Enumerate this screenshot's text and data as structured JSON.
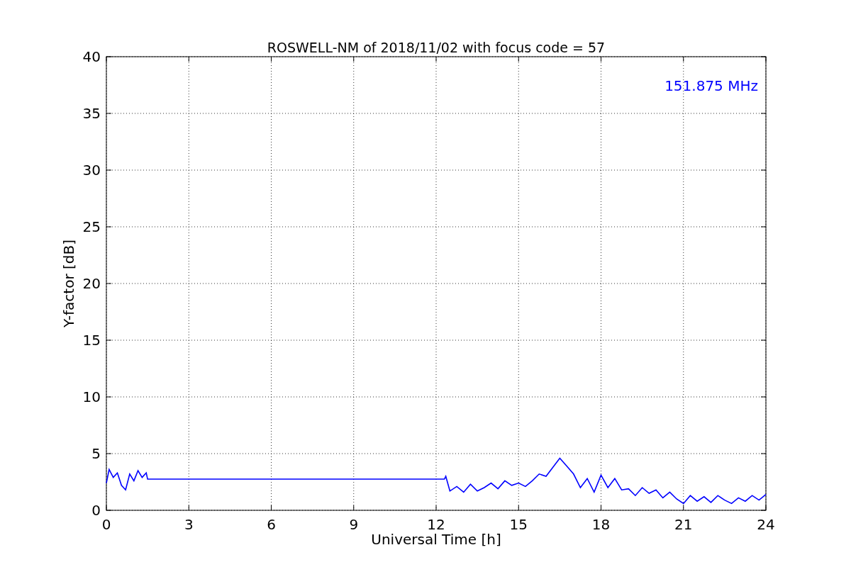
{
  "chart_data": {
    "type": "line",
    "title": "ROSWELL-NM of 2018/11/02 with focus code = 57",
    "xlabel": "Universal Time [h]",
    "ylabel": "Y-factor [dB]",
    "x": [
      0,
      0.1,
      0.25,
      0.4,
      0.55,
      0.7,
      0.85,
      1,
      1.15,
      1.3,
      1.45,
      1.5,
      12.3,
      12.35,
      12.5,
      12.75,
      13,
      13.25,
      13.5,
      13.75,
      14,
      14.25,
      14.5,
      14.75,
      15,
      15.25,
      15.5,
      15.75,
      16,
      16.25,
      16.5,
      16.75,
      17,
      17.25,
      17.5,
      17.75,
      18,
      18.25,
      18.5,
      18.75,
      19,
      19.25,
      19.5,
      19.75,
      20,
      20.25,
      20.5,
      20.75,
      21,
      21.25,
      21.5,
      21.75,
      22,
      22.25,
      22.5,
      22.75,
      23,
      23.25,
      23.5,
      23.75,
      24
    ],
    "series": [
      {
        "name": "151.875 MHz",
        "color": "#0000ff",
        "values": [
          2.4,
          3.6,
          2.9,
          3.3,
          2.2,
          1.8,
          3.2,
          2.6,
          3.5,
          2.9,
          3.3,
          2.75,
          2.75,
          3.0,
          1.7,
          2.1,
          1.6,
          2.3,
          1.7,
          2.0,
          2.4,
          1.9,
          2.6,
          2.2,
          2.4,
          2.1,
          2.6,
          3.2,
          3.0,
          3.8,
          4.6,
          3.9,
          3.2,
          2.0,
          2.8,
          1.6,
          3.1,
          2.0,
          2.8,
          1.8,
          1.9,
          1.3,
          2.0,
          1.5,
          1.8,
          1.1,
          1.6,
          1.0,
          0.6,
          1.3,
          0.8,
          1.2,
          0.7,
          1.3,
          0.9,
          0.6,
          1.1,
          0.8,
          1.3,
          0.9,
          1.4
        ]
      }
    ],
    "xlim": [
      0,
      24
    ],
    "ylim": [
      0,
      40
    ],
    "xticks": [
      0,
      3,
      6,
      9,
      12,
      15,
      18,
      21,
      24
    ],
    "yticks": [
      0,
      5,
      10,
      15,
      20,
      25,
      30,
      35,
      40
    ],
    "grid": true
  }
}
